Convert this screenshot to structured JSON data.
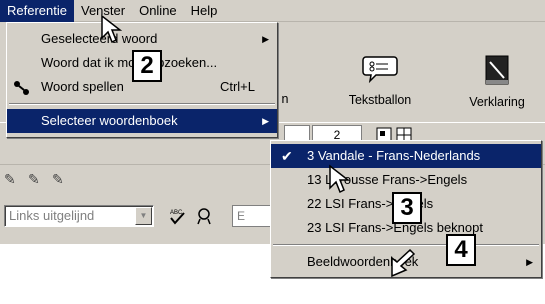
{
  "menubar": {
    "items": [
      {
        "label": "Referentie",
        "active": true
      },
      {
        "label": "Venster"
      },
      {
        "label": "Online"
      },
      {
        "label": "Help"
      }
    ]
  },
  "toolbar": {
    "tekstballon_label": "Tekstballon",
    "verklaring_label": "Verklaring",
    "partial_label": "n"
  },
  "row2": {
    "page_value": "2"
  },
  "format": {
    "align_placeholder": "Links uitgelijnd",
    "partial_box": "E"
  },
  "referentie_menu": {
    "items": [
      {
        "label": "Geselecteerd woord",
        "submenu": true
      },
      {
        "label": "Woord dat ik moet opzoeken..."
      },
      {
        "label": "Woord spellen",
        "shortcut": "Ctrl+L",
        "icon": "spell-icon"
      },
      {
        "label": "Selecteer woordenboek",
        "submenu": true,
        "highlighted": true
      }
    ]
  },
  "woordenboek_menu": {
    "items": [
      {
        "label": "3 Vandale - Frans-Nederlands",
        "checked": true,
        "highlighted": true
      },
      {
        "label": "13 Larousse Frans->Engels"
      },
      {
        "label": "22 LSI Frans->Engels"
      },
      {
        "label": "23 LSI Frans->Engels beknopt"
      },
      {
        "label": "Beeldwoordenboek",
        "submenu": true
      }
    ]
  },
  "callouts": [
    "2",
    "3",
    "4"
  ],
  "colors": {
    "menu_bg": "#d4d0c8",
    "highlight": "#0a246a",
    "highlight_text": "#ffffff"
  }
}
